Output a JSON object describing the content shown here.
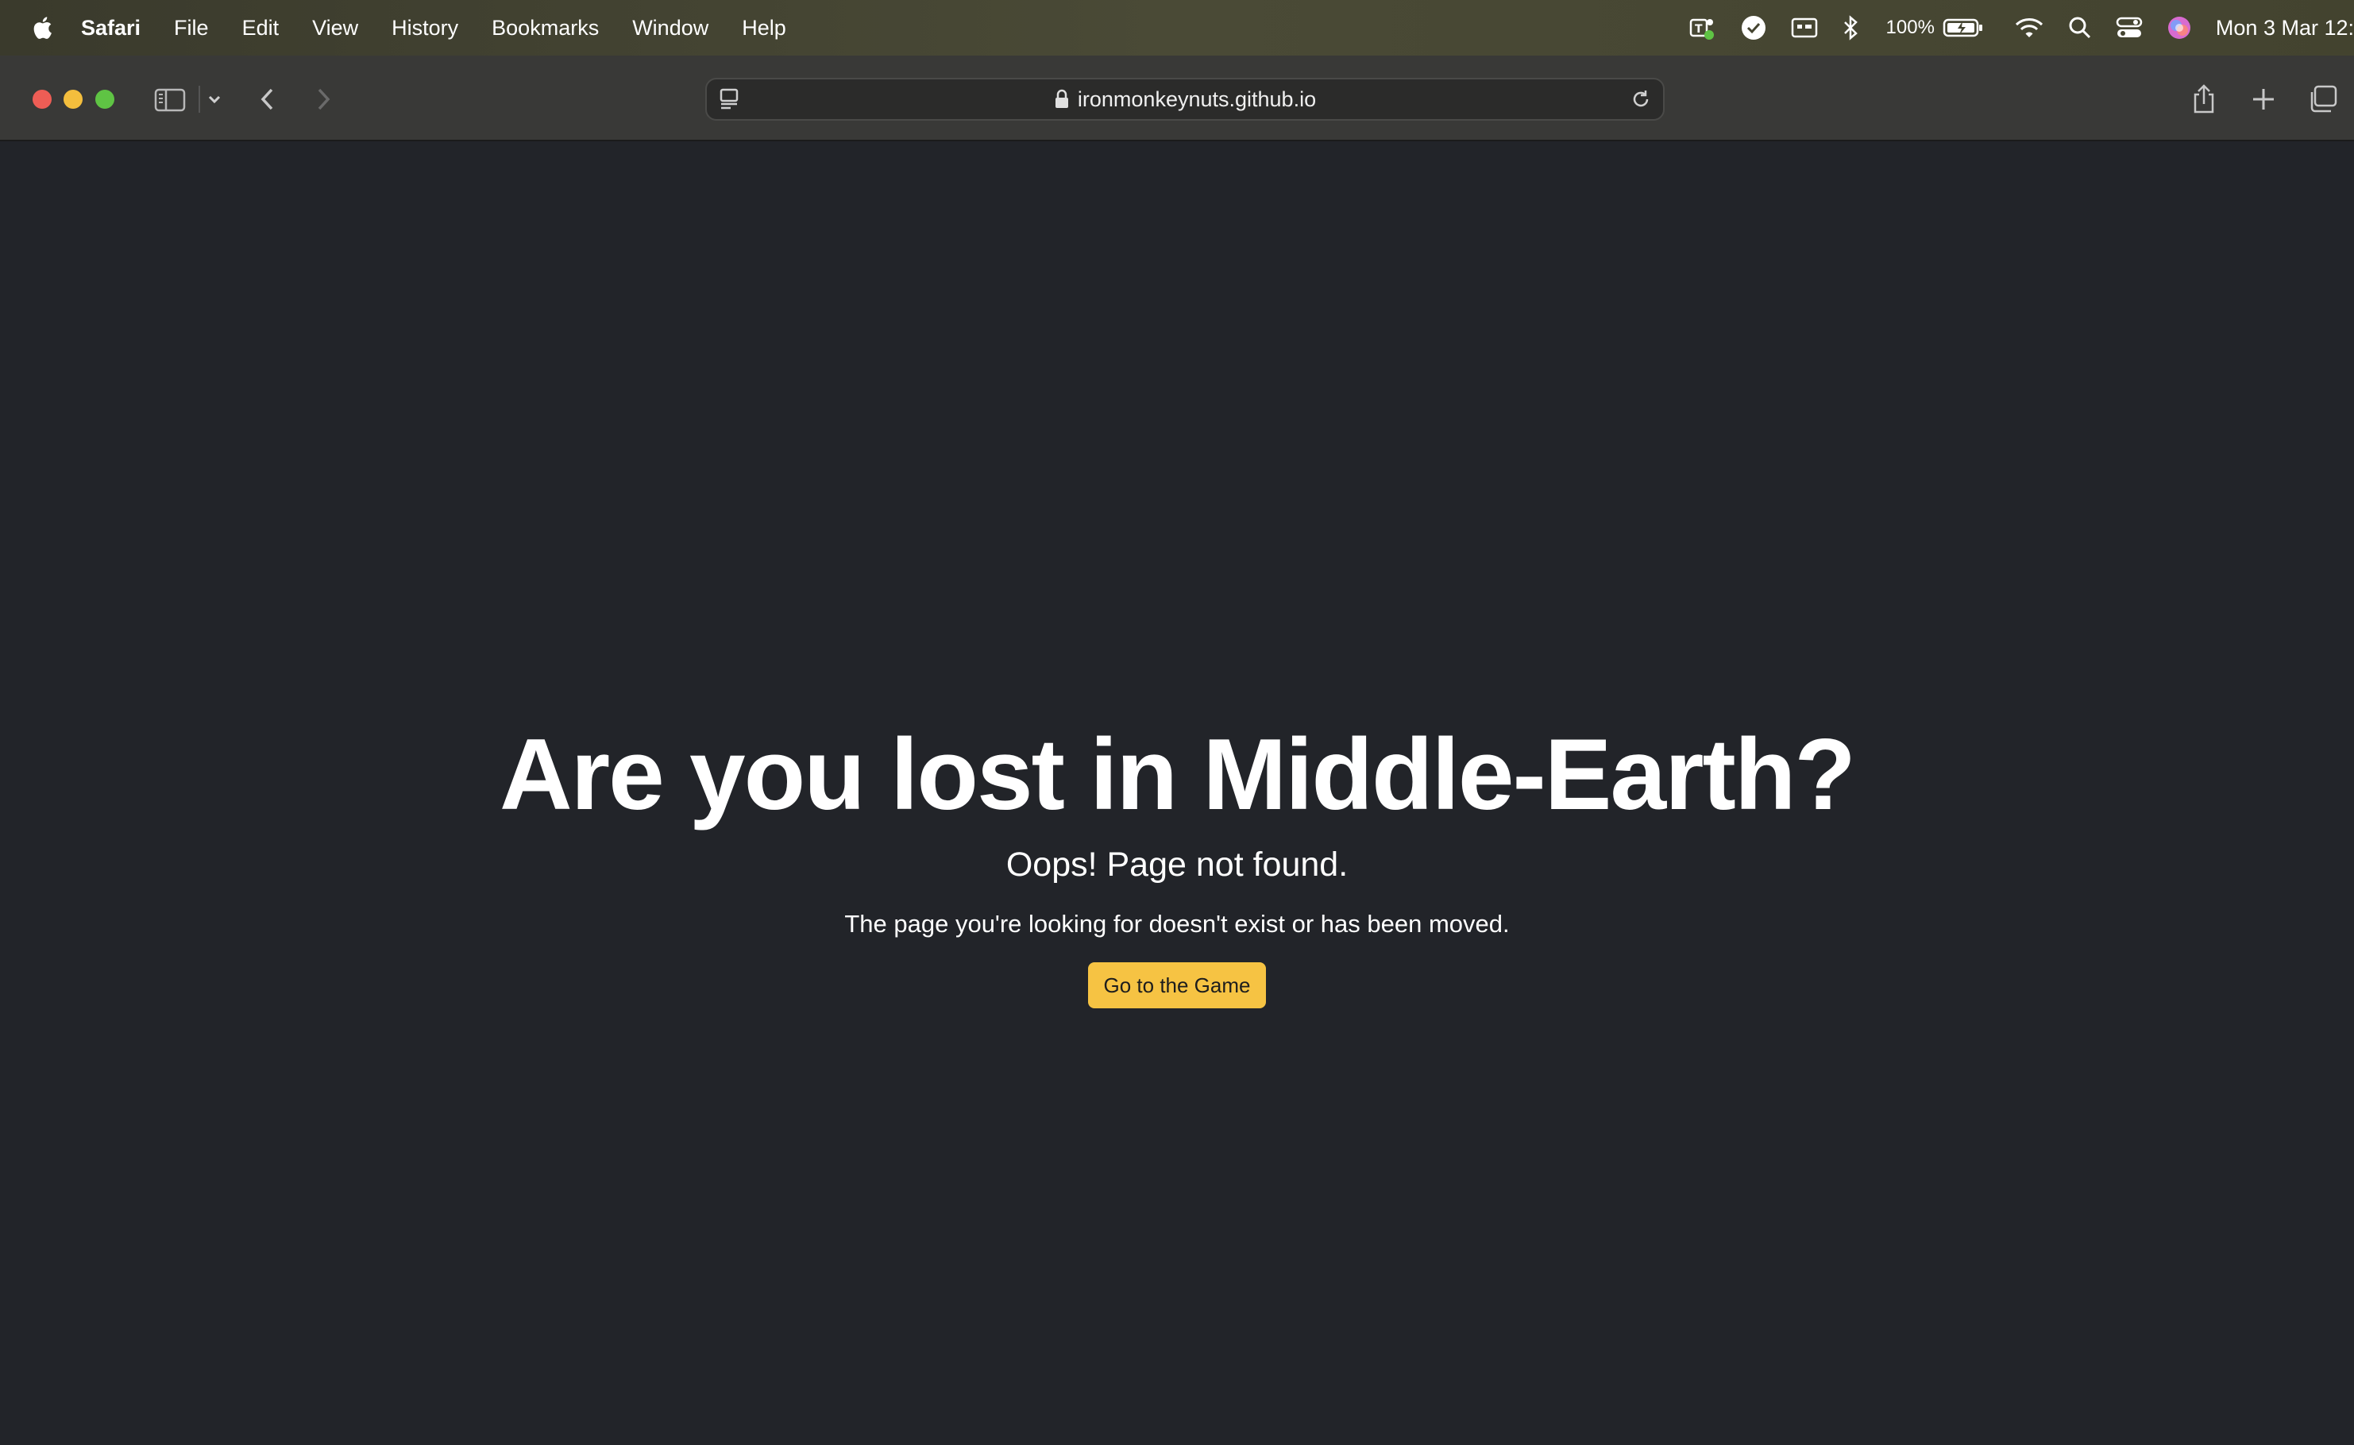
{
  "menubar": {
    "app_name": "Safari",
    "items": [
      "File",
      "Edit",
      "View",
      "History",
      "Bookmarks",
      "Window",
      "Help"
    ],
    "battery_percent": "100%",
    "clock": "Mon 3 Mar  12:"
  },
  "browser": {
    "url": "ironmonkeynuts.github.io"
  },
  "page": {
    "headline": "Are you lost in Middle-Earth?",
    "subheading": "Oops! Page not found.",
    "description": "The page you're looking for doesn't exist or has been moved.",
    "button_label": "Go to the Game"
  },
  "colors": {
    "page_background": "#222429",
    "button_background": "#f6c343",
    "toolbar_background": "#393937"
  }
}
